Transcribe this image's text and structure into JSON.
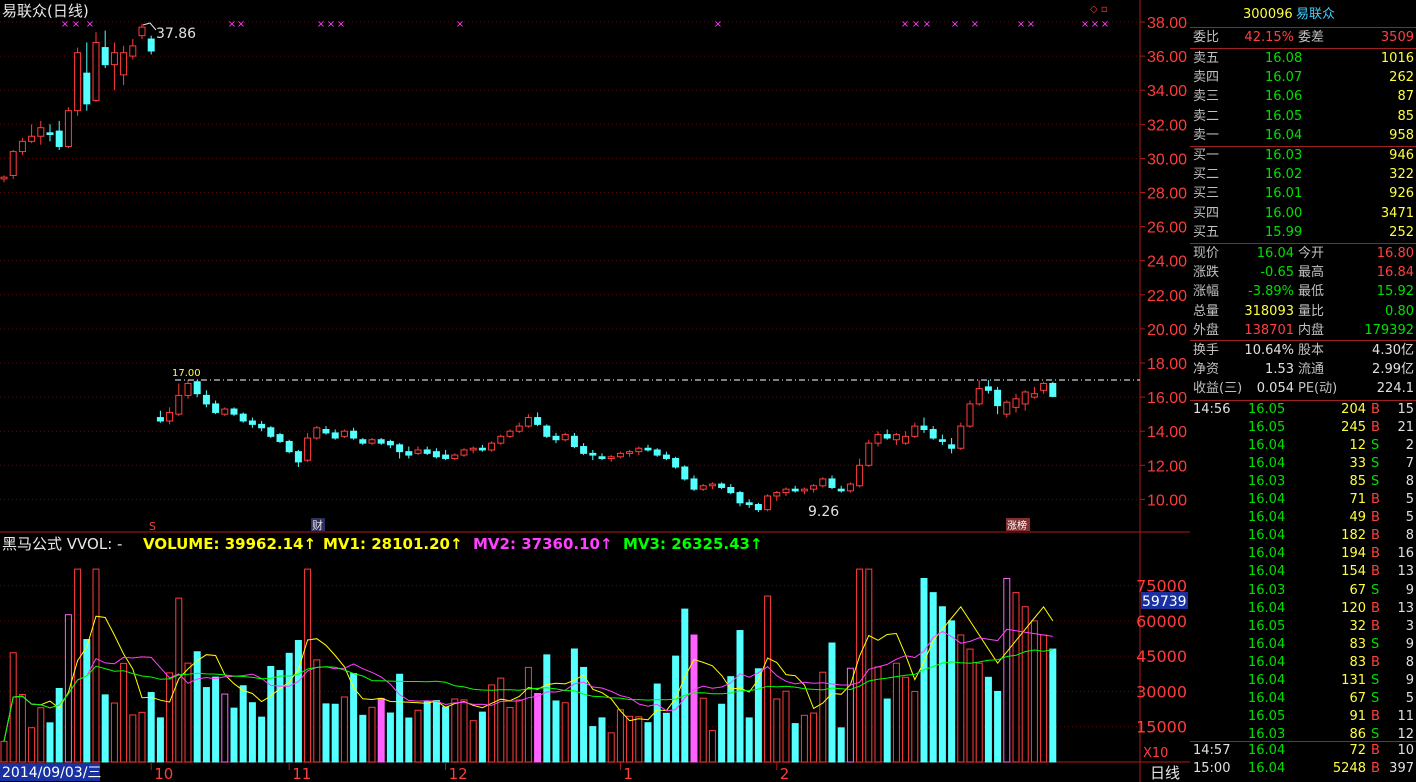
{
  "chart_data": [
    {
      "type": "candlestick",
      "title": "易联众(日线)",
      "y_ticks": [
        "38.00",
        "36.00",
        "34.00",
        "32.00",
        "30.00",
        "28.00",
        "26.00",
        "24.00",
        "22.00",
        "20.00",
        "18.00",
        "16.00",
        "14.00",
        "12.00",
        "10.00"
      ],
      "ylim": [
        8.0,
        38.6
      ],
      "x_ticks": [
        {
          "idx": 16,
          "label": "10"
        },
        {
          "idx": 31,
          "label": "11"
        },
        {
          "idx": 48,
          "label": "12"
        },
        {
          "idx": 67,
          "label": "1"
        },
        {
          "idx": 84,
          "label": "2"
        }
      ],
      "candles": [
        [
          28.8,
          29.0,
          28.6,
          28.9
        ],
        [
          29.0,
          30.5,
          28.8,
          30.4
        ],
        [
          30.4,
          31.2,
          30.2,
          31.0
        ],
        [
          31.0,
          32.0,
          30.9,
          31.3
        ],
        [
          31.3,
          32.2,
          30.8,
          31.8
        ],
        [
          31.5,
          32.0,
          31.0,
          31.4
        ],
        [
          31.6,
          32.2,
          30.5,
          30.7
        ],
        [
          30.7,
          33.0,
          30.6,
          32.8
        ],
        [
          32.8,
          36.5,
          32.5,
          36.2
        ],
        [
          35.0,
          36.8,
          32.8,
          33.2
        ],
        [
          33.4,
          37.4,
          33.3,
          36.8
        ],
        [
          36.5,
          37.5,
          35.3,
          35.5
        ],
        [
          35.5,
          36.8,
          34.0,
          36.2
        ],
        [
          34.9,
          36.6,
          34.3,
          36.2
        ],
        [
          36.0,
          37.0,
          35.8,
          36.6
        ],
        [
          37.2,
          37.9,
          37.0,
          37.7
        ],
        [
          37.0,
          37.2,
          36.1,
          36.3
        ],
        [
          14.8,
          15.2,
          14.5,
          14.6
        ],
        [
          14.6,
          15.4,
          14.4,
          15.1
        ],
        [
          15.0,
          16.8,
          14.9,
          16.1
        ],
        [
          16.1,
          17.0,
          15.9,
          16.8
        ],
        [
          16.9,
          17.0,
          16.0,
          16.2
        ],
        [
          16.1,
          16.4,
          15.4,
          15.6
        ],
        [
          15.6,
          15.8,
          15.0,
          15.1
        ],
        [
          15.0,
          15.4,
          14.9,
          15.3
        ],
        [
          15.3,
          15.4,
          14.9,
          15.0
        ],
        [
          15.0,
          15.1,
          14.5,
          14.6
        ],
        [
          14.6,
          14.8,
          14.2,
          14.4
        ],
        [
          14.4,
          14.6,
          14.0,
          14.2
        ],
        [
          14.2,
          14.3,
          13.6,
          13.7
        ],
        [
          13.8,
          13.9,
          13.3,
          13.4
        ],
        [
          13.4,
          13.5,
          12.7,
          12.8
        ],
        [
          12.8,
          12.9,
          11.9,
          12.2
        ],
        [
          12.3,
          13.9,
          12.2,
          13.6
        ],
        [
          13.6,
          14.3,
          13.5,
          14.2
        ],
        [
          14.1,
          14.3,
          13.8,
          13.9
        ],
        [
          13.9,
          14.1,
          13.5,
          13.6
        ],
        [
          13.7,
          14.1,
          13.6,
          14.0
        ],
        [
          14.0,
          14.2,
          13.5,
          13.6
        ],
        [
          13.5,
          13.6,
          13.2,
          13.3
        ],
        [
          13.3,
          13.6,
          13.2,
          13.5
        ],
        [
          13.5,
          13.6,
          13.2,
          13.3
        ],
        [
          13.4,
          13.5,
          13.0,
          13.2
        ],
        [
          13.2,
          13.3,
          12.4,
          12.8
        ],
        [
          12.8,
          13.1,
          12.4,
          12.6
        ],
        [
          12.7,
          13.1,
          12.6,
          12.9
        ],
        [
          12.9,
          13.1,
          12.6,
          12.7
        ],
        [
          12.8,
          13.0,
          12.4,
          12.5
        ],
        [
          12.6,
          12.9,
          12.3,
          12.4
        ],
        [
          12.4,
          12.7,
          12.3,
          12.6
        ],
        [
          12.6,
          13.0,
          12.5,
          12.9
        ],
        [
          12.9,
          13.1,
          12.7,
          13.0
        ],
        [
          13.0,
          13.2,
          12.8,
          12.9
        ],
        [
          12.9,
          13.4,
          12.8,
          13.3
        ],
        [
          13.3,
          13.8,
          13.2,
          13.7
        ],
        [
          13.7,
          14.1,
          13.6,
          14.0
        ],
        [
          14.0,
          14.5,
          13.9,
          14.3
        ],
        [
          14.3,
          15.0,
          14.2,
          14.8
        ],
        [
          14.8,
          15.1,
          14.3,
          14.4
        ],
        [
          14.3,
          14.4,
          13.6,
          13.7
        ],
        [
          13.7,
          13.9,
          13.3,
          13.5
        ],
        [
          13.5,
          13.9,
          13.4,
          13.8
        ],
        [
          13.7,
          13.9,
          13.0,
          13.1
        ],
        [
          13.1,
          13.3,
          12.6,
          12.7
        ],
        [
          12.7,
          12.9,
          12.3,
          12.6
        ],
        [
          12.5,
          12.7,
          12.3,
          12.4
        ],
        [
          12.4,
          12.6,
          12.2,
          12.5
        ],
        [
          12.5,
          12.8,
          12.4,
          12.7
        ],
        [
          12.7,
          12.9,
          12.5,
          12.8
        ],
        [
          12.8,
          13.1,
          12.6,
          13.0
        ],
        [
          13.0,
          13.2,
          12.8,
          12.9
        ],
        [
          12.9,
          13.0,
          12.5,
          12.6
        ],
        [
          12.6,
          12.8,
          12.3,
          12.4
        ],
        [
          12.4,
          12.5,
          11.8,
          11.9
        ],
        [
          11.9,
          12.0,
          11.1,
          11.2
        ],
        [
          11.2,
          11.4,
          10.5,
          10.6
        ],
        [
          10.6,
          10.9,
          10.5,
          10.8
        ],
        [
          10.8,
          11.0,
          10.6,
          10.9
        ],
        [
          10.9,
          11.0,
          10.6,
          10.7
        ],
        [
          10.7,
          10.9,
          10.3,
          10.4
        ],
        [
          10.4,
          10.5,
          9.6,
          9.8
        ],
        [
          9.8,
          10.0,
          9.5,
          9.7
        ]
      ],
      "candles_b": [
        [
          9.7,
          9.8,
          9.26,
          9.4
        ],
        [
          9.4,
          10.3,
          9.3,
          10.2
        ],
        [
          10.2,
          10.5,
          9.9,
          10.4
        ],
        [
          10.4,
          10.7,
          10.2,
          10.6
        ],
        [
          10.6,
          10.8,
          10.4,
          10.5
        ],
        [
          10.5,
          10.7,
          10.3,
          10.6
        ],
        [
          10.6,
          10.9,
          10.4,
          10.8
        ],
        [
          10.8,
          11.3,
          10.7,
          11.2
        ],
        [
          11.2,
          11.4,
          10.6,
          10.7
        ],
        [
          10.6,
          10.8,
          10.4,
          10.5
        ],
        [
          10.5,
          11.0,
          10.4,
          10.9
        ],
        [
          10.8,
          12.4,
          10.7,
          12.0
        ],
        [
          12.0,
          13.5,
          11.9,
          13.3
        ],
        [
          13.3,
          14.0,
          13.1,
          13.8
        ],
        [
          13.8,
          14.1,
          13.5,
          13.6
        ],
        [
          13.5,
          13.9,
          13.2,
          13.8
        ],
        [
          13.3,
          14.0,
          13.2,
          13.7
        ],
        [
          13.7,
          14.5,
          13.6,
          14.3
        ],
        [
          14.3,
          14.8,
          13.9,
          14.1
        ],
        [
          14.1,
          14.3,
          13.5,
          13.6
        ],
        [
          13.5,
          13.8,
          13.2,
          13.4
        ],
        [
          13.2,
          13.6,
          12.7,
          13.0
        ],
        [
          13.0,
          14.5,
          12.9,
          14.3
        ],
        [
          14.3,
          15.8,
          14.2,
          15.6
        ],
        [
          15.6,
          17.0,
          15.5,
          16.5
        ],
        [
          16.6,
          17.0,
          16.2,
          16.4
        ],
        [
          16.4,
          16.6,
          15.0,
          15.5
        ],
        [
          15.0,
          15.8,
          14.8,
          15.7
        ],
        [
          15.4,
          16.2,
          15.1,
          15.9
        ],
        [
          15.6,
          16.4,
          15.2,
          16.3
        ],
        [
          16.0,
          16.6,
          15.9,
          16.2
        ],
        [
          16.4,
          16.9,
          16.2,
          16.8
        ],
        [
          16.8,
          16.9,
          16.0,
          16.04
        ]
      ],
      "annotations": {
        "high": "37.86",
        "low": "9.26",
        "resist": "17.00"
      },
      "markers": [
        "S",
        "财",
        "涨榜"
      ],
      "volume": {
        "title": "黑马公式 VVOL: -",
        "legend": [
          {
            "name": "VOLUME",
            "value": "39962.14",
            "color": "#ffff00"
          },
          {
            "name": "MV1",
            "value": "28101.20",
            "color": "#ffff00"
          },
          {
            "name": "MV2",
            "value": "37360.10",
            "color": "#ff40ff"
          },
          {
            "name": "MV3",
            "value": "26325.43",
            "color": "#00ff00"
          }
        ],
        "y_ticks": [
          "75000",
          "60000",
          "45000",
          "30000",
          "15000"
        ],
        "ylim": [
          0,
          88000
        ],
        "current_label": "59739",
        "unit_label": "X10"
      }
    }
  ],
  "header": {
    "title": "易联众(日线)",
    "date": "2014/09/03/三",
    "period": "日线"
  },
  "quote": {
    "code": "300096",
    "name": "易联众",
    "weibi_label": "委比",
    "weibi": "42.15%",
    "weicha_label": "委差",
    "weicha": "3509",
    "sells": [
      {
        "label": "卖五",
        "price": "16.08",
        "vol": "1016"
      },
      {
        "label": "卖四",
        "price": "16.07",
        "vol": "262"
      },
      {
        "label": "卖三",
        "price": "16.06",
        "vol": "87"
      },
      {
        "label": "卖二",
        "price": "16.05",
        "vol": "85"
      },
      {
        "label": "卖一",
        "price": "16.04",
        "vol": "958"
      }
    ],
    "buys": [
      {
        "label": "买一",
        "price": "16.03",
        "vol": "946"
      },
      {
        "label": "买二",
        "price": "16.02",
        "vol": "322"
      },
      {
        "label": "买三",
        "price": "16.01",
        "vol": "926"
      },
      {
        "label": "买四",
        "price": "16.00",
        "vol": "3471"
      },
      {
        "label": "买五",
        "price": "15.99",
        "vol": "252"
      }
    ],
    "stats": [
      {
        "l1": "现价",
        "v1": "16.04",
        "c1": "dn",
        "l2": "今开",
        "v2": "16.80",
        "c2": "up"
      },
      {
        "l1": "涨跌",
        "v1": "-0.65",
        "c1": "dn",
        "l2": "最高",
        "v2": "16.84",
        "c2": "up"
      },
      {
        "l1": "涨幅",
        "v1": "-3.89%",
        "c1": "dn",
        "l2": "最低",
        "v2": "15.92",
        "c2": "dn"
      },
      {
        "l1": "总量",
        "v1": "318093",
        "c1": "yl",
        "l2": "量比",
        "v2": "0.80",
        "c2": "dn"
      },
      {
        "l1": "外盘",
        "v1": "138701",
        "c1": "up",
        "l2": "内盘",
        "v2": "179392",
        "c2": "dn"
      }
    ],
    "stats2": [
      {
        "l1": "换手",
        "v1": "10.64%",
        "l2": "股本",
        "v2": "4.30亿"
      },
      {
        "l1": "净资",
        "v1": "1.53",
        "l2": "流通",
        "v2": "2.99亿"
      },
      {
        "l1": "收益(三)",
        "v1": "0.054",
        "l2": "PE(动)",
        "v2": "224.1"
      }
    ],
    "ticks": [
      {
        "t": "14:56",
        "p": "16.05",
        "pc": "dn",
        "v": "204",
        "bs": "B",
        "n": "15"
      },
      {
        "t": "",
        "p": "16.05",
        "pc": "dn",
        "v": "245",
        "bs": "B",
        "n": "21"
      },
      {
        "t": "",
        "p": "16.04",
        "pc": "dn",
        "v": "12",
        "bs": "S",
        "n": "2"
      },
      {
        "t": "",
        "p": "16.04",
        "pc": "dn",
        "v": "33",
        "bs": "S",
        "n": "7"
      },
      {
        "t": "",
        "p": "16.03",
        "pc": "dn",
        "v": "85",
        "bs": "S",
        "n": "8"
      },
      {
        "t": "",
        "p": "16.04",
        "pc": "dn",
        "v": "71",
        "bs": "B",
        "n": "5"
      },
      {
        "t": "",
        "p": "16.04",
        "pc": "dn",
        "v": "49",
        "bs": "B",
        "n": "5"
      },
      {
        "t": "",
        "p": "16.04",
        "pc": "dn",
        "v": "182",
        "bs": "B",
        "n": "8"
      },
      {
        "t": "",
        "p": "16.04",
        "pc": "dn",
        "v": "194",
        "bs": "B",
        "n": "16"
      },
      {
        "t": "",
        "p": "16.04",
        "pc": "dn",
        "v": "154",
        "bs": "B",
        "n": "13"
      },
      {
        "t": "",
        "p": "16.03",
        "pc": "dn",
        "v": "67",
        "bs": "S",
        "n": "9"
      },
      {
        "t": "",
        "p": "16.04",
        "pc": "dn",
        "v": "120",
        "bs": "B",
        "n": "13"
      },
      {
        "t": "",
        "p": "16.05",
        "pc": "dn",
        "v": "32",
        "bs": "B",
        "n": "3"
      },
      {
        "t": "",
        "p": "16.04",
        "pc": "dn",
        "v": "83",
        "bs": "S",
        "n": "9"
      },
      {
        "t": "",
        "p": "16.04",
        "pc": "dn",
        "v": "83",
        "bs": "B",
        "n": "8"
      },
      {
        "t": "",
        "p": "16.04",
        "pc": "dn",
        "v": "131",
        "bs": "S",
        "n": "9"
      },
      {
        "t": "",
        "p": "16.04",
        "pc": "dn",
        "v": "67",
        "bs": "S",
        "n": "5"
      },
      {
        "t": "",
        "p": "16.05",
        "pc": "dn",
        "v": "91",
        "bs": "B",
        "n": "11"
      },
      {
        "t": "",
        "p": "16.03",
        "pc": "dn",
        "v": "86",
        "bs": "S",
        "n": "12"
      },
      {
        "t": "14:57",
        "p": "16.04",
        "pc": "dn",
        "v": "72",
        "bs": "B",
        "n": "10"
      },
      {
        "t": "15:00",
        "p": "16.04",
        "pc": "dn",
        "v": "5248",
        "bs": "B",
        "n": "397"
      }
    ]
  }
}
